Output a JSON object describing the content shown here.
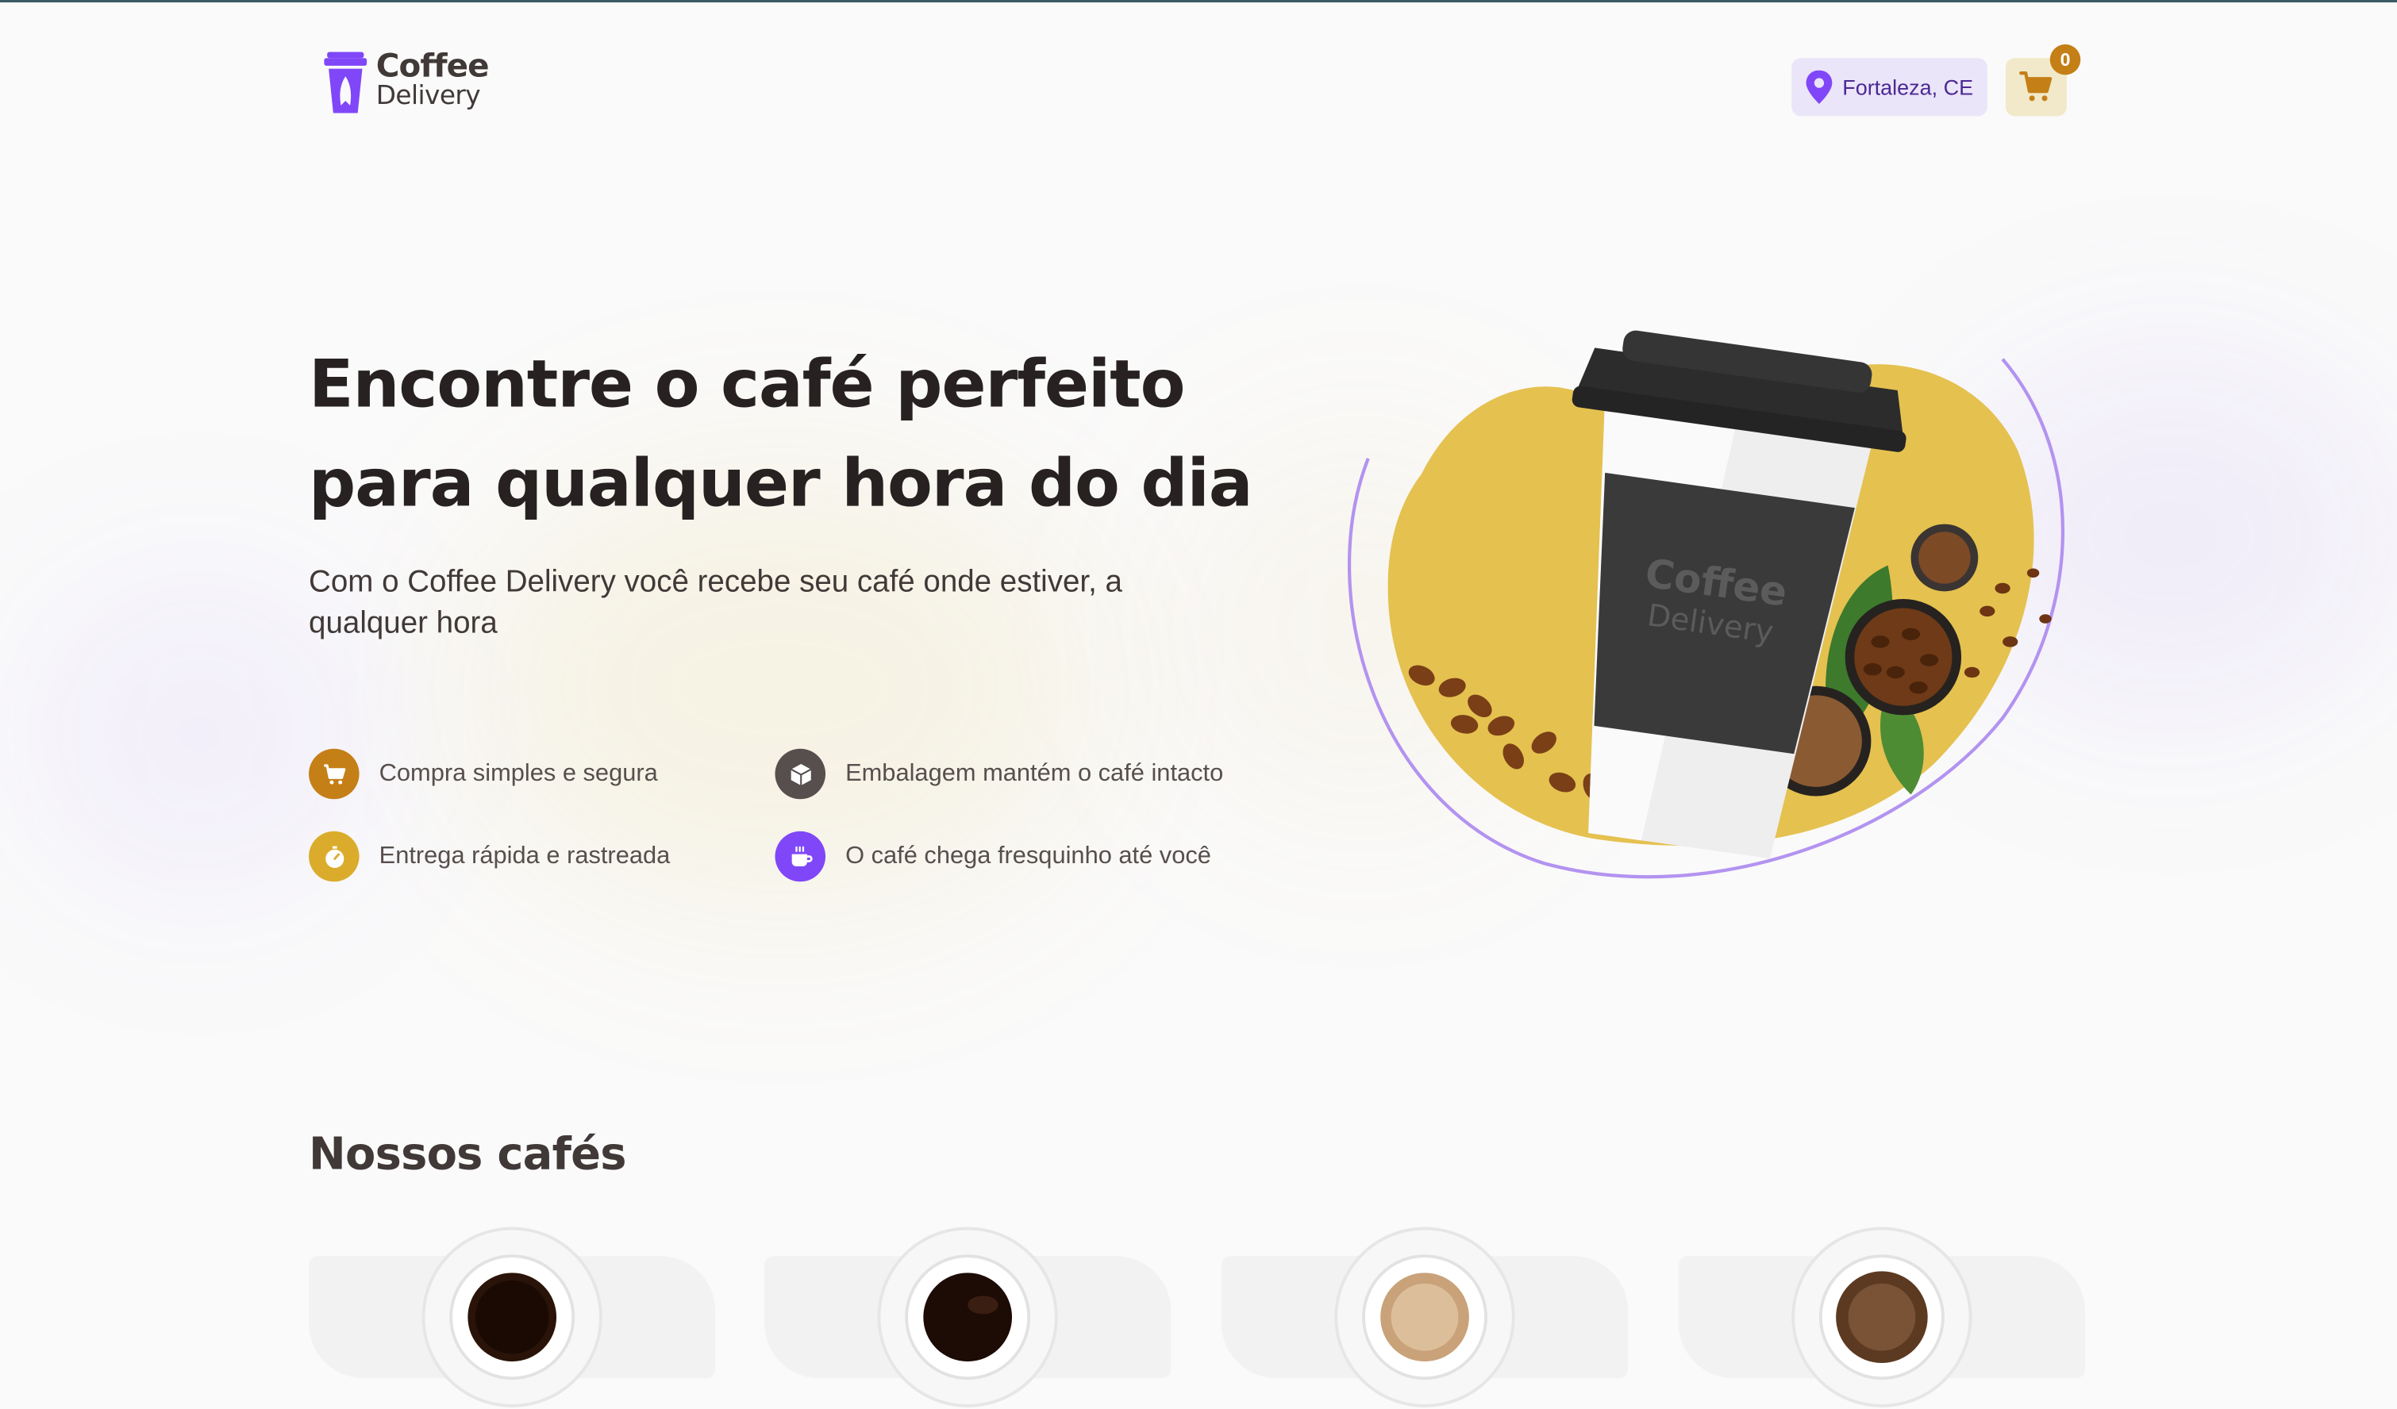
{
  "header": {
    "logo_line1": "Coffee",
    "logo_line2": "Delivery",
    "location": "Fortaleza, CE",
    "cart_count": "0"
  },
  "hero": {
    "title": "Encontre o café perfeito para qualquer hora do dia",
    "subtitle": "Com o Coffee Delivery você recebe seu café onde estiver, a qualquer hora",
    "cup_logo_line1": "Coffee",
    "cup_logo_line2": "Delivery",
    "features": [
      {
        "label": "Compra simples e segura",
        "icon": "cart-icon",
        "color": "#c47f17"
      },
      {
        "label": "Embalagem mantém o café intacto",
        "icon": "package-icon",
        "color": "#574f4d"
      },
      {
        "label": "Entrega rápida e rastreada",
        "icon": "timer-icon",
        "color": "#dbac2c"
      },
      {
        "label": "O café chega fresquinho até você",
        "icon": "coffee-icon",
        "color": "#8047f8"
      }
    ]
  },
  "catalog": {
    "title": "Nossos cafés"
  },
  "colors": {
    "yellow_dark": "#c47f17",
    "yellow": "#dbac2c",
    "yellow_light": "#f1e9c9",
    "purple_dark": "#4b2995",
    "purple": "#8047f8",
    "purple_light": "#ebe5f9"
  }
}
